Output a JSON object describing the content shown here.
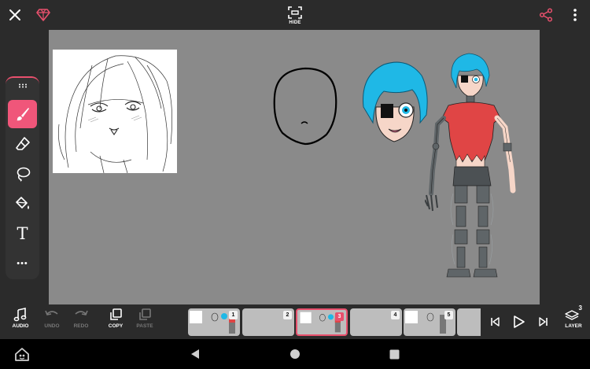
{
  "toolbar": {
    "hide_label": "HIDE"
  },
  "colors": {
    "accent": "#e8506d",
    "canvas": "#8a8a8a",
    "bar": "#2b2b2b",
    "hair": "#1fb8e6",
    "shirt": "#e04545",
    "metal": "#5f6568"
  },
  "tools": [
    {
      "name": "brush",
      "icon": "brush-icon",
      "active": true
    },
    {
      "name": "eraser",
      "icon": "eraser-icon"
    },
    {
      "name": "lasso",
      "icon": "lasso-icon"
    },
    {
      "name": "fill",
      "icon": "paint-bucket-icon"
    },
    {
      "name": "text",
      "icon": "text-icon",
      "glyph": "T"
    },
    {
      "name": "more",
      "icon": "more-horizontal-icon",
      "glyph": "•••"
    }
  ],
  "bottom": {
    "audio_label": "AUDIO",
    "undo_label": "UNDO",
    "redo_label": "REDO",
    "copy_label": "COPY",
    "paste_label": "PASTE",
    "layer_label": "LAYER",
    "layer_count": "3"
  },
  "frames": [
    {
      "number": "1"
    },
    {
      "number": "2"
    },
    {
      "number": "3",
      "active": true
    },
    {
      "number": "4"
    },
    {
      "number": "5"
    },
    {
      "number": ""
    }
  ]
}
